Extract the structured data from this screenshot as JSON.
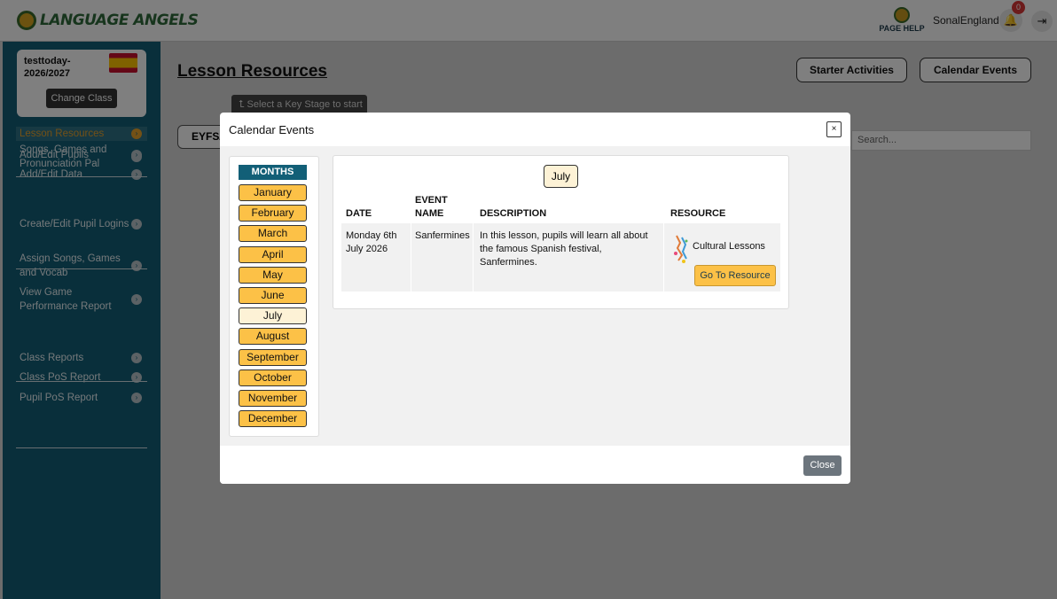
{
  "header": {
    "logo_text": "LANGUAGE ANGELS",
    "page_help": "PAGE HELP",
    "username": "SonalEngland",
    "notification_count": "0",
    "logout_icon": "logout-icon"
  },
  "sidebar": {
    "class_name": "testtoday-2026/2027",
    "change_class": "Change Class",
    "groups": [
      [
        {
          "label": "Lesson Resources",
          "active": true
        },
        {
          "label": "Songs, Games and Pronunciation Pal"
        }
      ],
      [
        {
          "label": "Add/Edit Pupils"
        },
        {
          "label": "Add/Edit Data"
        }
      ],
      [
        {
          "label": "Create/Edit Pupil Logins"
        },
        {
          "label": "Assign Songs, Games and Vocab"
        },
        {
          "label": "View Game Performance Report"
        }
      ],
      [
        {
          "label": "Class Reports"
        },
        {
          "label": "Class PoS Report"
        },
        {
          "label": "Pupil PoS Report"
        }
      ]
    ]
  },
  "main": {
    "title": "Lesson Resources",
    "starter_activities": "Starter Activities",
    "calendar_events": "Calendar Events",
    "key_stage_tip": "Select a Key Stage to start",
    "eyfs_label": "EYFS/",
    "search_placeholder": "Search..."
  },
  "modal": {
    "title": "Calendar Events",
    "close_x": "×",
    "months_header": "MONTHS",
    "months": [
      "January",
      "February",
      "March",
      "April",
      "May",
      "June",
      "July",
      "August",
      "September",
      "October",
      "November",
      "December"
    ],
    "selected_month": "July",
    "table": {
      "headers": {
        "date": "DATE",
        "event_name": "EVENT NAME",
        "description": "DESCRIPTION",
        "resource": "RESOURCE"
      },
      "rows": [
        {
          "date": "Monday 6th July 2026",
          "event_name": "Sanfermines",
          "description": "In this lesson, pupils will learn all about the famous Spanish festival, Sanfermines.",
          "resource": "Cultural Lessons",
          "resource_button": "Go To Resource"
        }
      ]
    },
    "close_button": "Close"
  },
  "colors": {
    "sidebar": "#125f77",
    "accent": "#fcc147",
    "selected_month": "#fdf2d6",
    "close_button": "#6c757d"
  }
}
